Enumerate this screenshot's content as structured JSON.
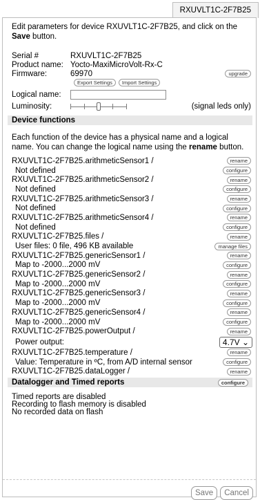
{
  "tab": {
    "label": "RXUVLT1C-2F7B25"
  },
  "intro": {
    "before": "Edit parameters for device RXUVLT1C-2F7B25, and click on the ",
    "bold": "Save",
    "after": " button."
  },
  "device": {
    "serial_label": "Serial #",
    "serial": "RXUVLT1C-2F7B25",
    "product_label": "Product name:",
    "product": "Yocto-MaxiMicroVolt-Rx-C",
    "firmware_label": "Firmware:",
    "firmware": "69970",
    "upgrade_btn": "upgrade",
    "export_btn": "Export Settings",
    "import_btn": "Import Settings",
    "logical_label": "Logical name:",
    "logical_value": "",
    "luminosity_label": "Luminosity:",
    "luminosity_note": "(signal leds only)",
    "luminosity_level": 0.5
  },
  "functions": {
    "title": "Device functions",
    "intro_before": "Each function of the device has a physical name and a logical name. You can change the logical name using the ",
    "intro_bold": "rename",
    "intro_after": " button.",
    "items": [
      {
        "name": "RXUVLT1C-2F7B25.arithmeticSensor1 /",
        "rename": "rename",
        "value": "Not defined",
        "action": "configure"
      },
      {
        "name": "RXUVLT1C-2F7B25.arithmeticSensor2 /",
        "rename": "rename",
        "value": "Not defined",
        "action": "configure"
      },
      {
        "name": "RXUVLT1C-2F7B25.arithmeticSensor3 /",
        "rename": "rename",
        "value": "Not defined",
        "action": "configure"
      },
      {
        "name": "RXUVLT1C-2F7B25.arithmeticSensor4 /",
        "rename": "rename",
        "value": "Not defined",
        "action": "configure"
      },
      {
        "name": "RXUVLT1C-2F7B25.files /",
        "rename": "rename",
        "value": "User files: 0 file, 496 KB available",
        "action": "manage files"
      },
      {
        "name": "RXUVLT1C-2F7B25.genericSensor1 /",
        "rename": "rename",
        "value": "Map to -2000...2000 mV",
        "action": "configure"
      },
      {
        "name": "RXUVLT1C-2F7B25.genericSensor2 /",
        "rename": "rename",
        "value": "Map to -2000...2000 mV",
        "action": "configure"
      },
      {
        "name": "RXUVLT1C-2F7B25.genericSensor3 /",
        "rename": "rename",
        "value": "Map to -2000...2000 mV",
        "action": "configure"
      },
      {
        "name": "RXUVLT1C-2F7B25.genericSensor4 /",
        "rename": "rename",
        "value": "Map to -2000...2000 mV",
        "action": "configure"
      }
    ],
    "power": {
      "name": "RXUVLT1C-2F7B25.powerOutput /",
      "rename": "rename",
      "value": "Power output:",
      "selected": "4.7V"
    },
    "temperature": {
      "name": "RXUVLT1C-2F7B25.temperature /",
      "rename": "rename",
      "value": "Value: Temperature in ºC, from A/D internal sensor",
      "action": "configure"
    },
    "datalogger": {
      "name": "RXUVLT1C-2F7B25.dataLogger /",
      "rename": "rename"
    }
  },
  "datalogger": {
    "title": "Datalogger and Timed reports",
    "configure": "configure",
    "lines": [
      "Timed reports are disabled",
      "Recording to flash memory is disabled",
      "No recorded data on flash"
    ]
  },
  "footer": {
    "save": "Save",
    "cancel": "Cancel"
  }
}
